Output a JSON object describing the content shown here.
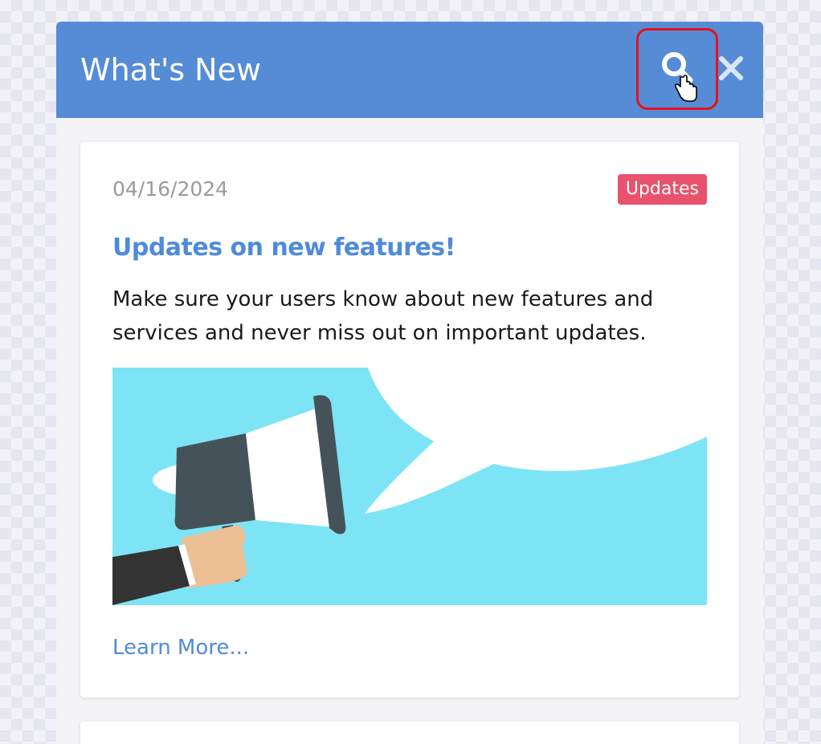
{
  "header": {
    "title": "What's New",
    "background_color": "#568cd6",
    "search_icon": "search-icon",
    "close_icon": "close-icon"
  },
  "feed": {
    "items": [
      {
        "date": "04/16/2024",
        "category": "Updates",
        "category_color": "#e8526d",
        "title": "Updates on new features!",
        "description": "Make sure your users know about new features and services and never miss out on important updates.",
        "illustration": "megaphone-illustration",
        "link_label": "Learn More..."
      }
    ]
  },
  "colors": {
    "accent": "#4f8bd9",
    "highlight_border": "#e8101e",
    "illustration_background": "#7de4f6"
  }
}
